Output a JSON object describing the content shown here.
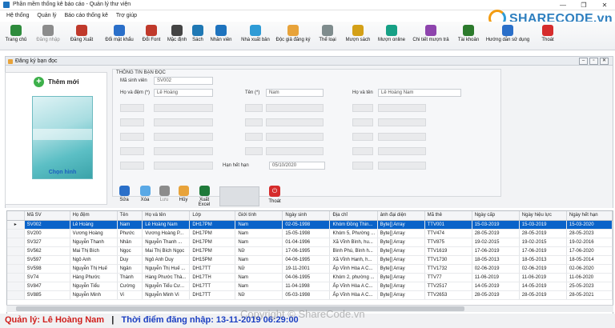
{
  "window": {
    "title": "Phần mềm thống kê báo cáo - Quản lý thư viện",
    "controls": [
      "—",
      "❐",
      "✕"
    ]
  },
  "menu": [
    "Hệ thống",
    "Quản lý",
    "Báo cáo thống kê",
    "Trợ giúp"
  ],
  "brand": {
    "text": "SHARECODE.vn"
  },
  "toolbar": [
    {
      "label": "Trang chủ",
      "icon": "home-icon",
      "color": "#2e8b3c",
      "disabled": false
    },
    {
      "label": "Đăng nhập",
      "icon": "login-icon",
      "color": "#8c8c8c",
      "disabled": true
    },
    {
      "label": "Đăng Xuất",
      "icon": "logout-icon",
      "color": "#c0392b",
      "disabled": false
    },
    {
      "label": "Đổi mật khẩu",
      "icon": "monitor-icon",
      "color": "#2a6fc9",
      "disabled": false
    },
    {
      "label": "Đổi Font",
      "icon": "font-icon",
      "color": "#c0392b",
      "disabled": false
    },
    {
      "label": "Mặc định",
      "icon": "gear-icon",
      "color": "#444444",
      "disabled": false
    },
    {
      "label": "Sách",
      "icon": "book-icon",
      "color": "#1f78b4",
      "disabled": false
    },
    {
      "label": "Nhân viên",
      "icon": "user-icon",
      "color": "#1e73be",
      "disabled": false
    },
    {
      "label": "Nhà xuất bản",
      "icon": "bird-icon",
      "color": "#2e9bd6",
      "disabled": false
    },
    {
      "label": "Độc giả đăng ký",
      "icon": "reader-icon",
      "color": "#e8a33a",
      "disabled": false
    },
    {
      "label": "Thể loại",
      "icon": "category-icon",
      "color": "#7f8c8d",
      "disabled": false
    },
    {
      "label": "Mượn sách",
      "icon": "borrow-icon",
      "color": "#d4a017",
      "disabled": false
    },
    {
      "label": "Mượn online",
      "icon": "online-icon",
      "color": "#16a085",
      "disabled": false
    },
    {
      "label": "Chi tiết mượn trả",
      "icon": "detail-icon",
      "color": "#8e44ad",
      "disabled": false
    },
    {
      "label": "Tài khoản",
      "icon": "account-icon",
      "color": "#2c7a2c",
      "disabled": false
    },
    {
      "label": "Hướng dẫn sử dụng",
      "icon": "help-icon",
      "color": "#2a6fc9",
      "disabled": false
    },
    {
      "label": "Thoát",
      "icon": "power-icon",
      "color": "#d62c2c",
      "disabled": false
    }
  ],
  "subwindow": {
    "title": "Đăng ký bạn đọc"
  },
  "form": {
    "add_button": "Thêm mới",
    "photo_caption": "Chọn hình",
    "group_title": "THÔNG TIN BẠN ĐỌC",
    "ma_sv_label": "Mã sinh viên",
    "ma_sv_value": "SV002",
    "ho_dem_label": "Họ và đệm (*)",
    "ho_dem_value": "Lê Hoàng",
    "ten_label": "Tên (*)",
    "ten_value": "Nam",
    "ho_ten_label": "Họ và tên",
    "ho_ten_value": "Lê Hoàng Nam",
    "han_label": "Hạn hết hạn",
    "han_value": "05/10/2020"
  },
  "actions": [
    {
      "label": "Sửa",
      "icon": "edit-icon",
      "color": "#2a6fc9",
      "disabled": false
    },
    {
      "label": "Xóa",
      "icon": "delete-icon",
      "color": "#5aa9e6",
      "disabled": false
    },
    {
      "label": "Lưu",
      "icon": "save-icon",
      "color": "#8c8c8c",
      "disabled": true
    },
    {
      "label": "Hủy",
      "icon": "undo-icon",
      "color": "#e8a33a",
      "disabled": false
    },
    {
      "label": "Xuất Excel",
      "icon": "excel-icon",
      "color": "#1f7a3a",
      "disabled": false
    }
  ],
  "exit_action": {
    "label": "Thoát"
  },
  "table": {
    "columns": [
      "Mã SV",
      "Họ đệm",
      "Tên",
      "Họ và tên",
      "Lớp",
      "Giới tính",
      "Ngày sinh",
      "Địa chỉ",
      "ảnh đại diện",
      "Mã thẻ",
      "Ngày cấp",
      "Ngày hiệu lực",
      "Ngày hết hạn"
    ],
    "rows": [
      [
        "SV002",
        "Lê Hoàng",
        "Nam",
        "Lê Hoàng Nam",
        "DH17PM",
        "Nam",
        "02-05-1998",
        "Khóm Đồng Thin...",
        "Byte[] Array",
        "TTV001",
        "15-03-2019",
        "15-03-2019",
        "15-03-2020"
      ],
      [
        "SV200",
        "Vương Hoàng",
        "Phước",
        "Vương Hoàng P...",
        "DH17PM",
        "Nam",
        "15-05-1998",
        "Khóm 5, Phường ...",
        "Byte[] Array",
        "TTV474",
        "28-05-2019",
        "28-05-2019",
        "28-05-2023"
      ],
      [
        "SV327",
        "Nguyễn Thanh",
        "Nhân",
        "Nguyễn Thanh ...",
        "DH17PM",
        "Nam",
        "01-04-1996",
        "Xã Vĩnh Bình, hu...",
        "Byte[] Array",
        "TTV875",
        "19-02-2015",
        "19-02-2015",
        "19-02-2016"
      ],
      [
        "SV562",
        "Mai Thị Bích",
        "Ngọc",
        "Mai Thị Bích Ngọc",
        "DH17PM",
        "Nữ",
        "17-06-1995",
        "Bình Phú, Bình h...",
        "Byte[] Array",
        "TTV1619",
        "17-06-2019",
        "17-06-2019",
        "17-06-2020"
      ],
      [
        "SV597",
        "Ngô Anh",
        "Duy",
        "Ngô Anh Duy",
        "DH15PM",
        "Nam",
        "04-06-1995",
        "Xã Vĩnh Hanh, h...",
        "Byte[] Array",
        "TTV1730",
        "18-05-2013",
        "18-05-2013",
        "18-05-2014"
      ],
      [
        "SV598",
        "Nguyễn Thị Huế",
        "Ngân",
        "Nguyễn Thị Huế ...",
        "DH17TT",
        "Nữ",
        "19-11-2001",
        "Ấp Vĩnh Hòa A C...",
        "Byte[] Array",
        "TTV1732",
        "02-06-2019",
        "02-06-2019",
        "02-06-2020"
      ],
      [
        "SV74",
        "Hàng Phước",
        "Thành",
        "Hàng Phước Thà...",
        "DH17TH",
        "Nam",
        "04-06-1995",
        "Khóm 2, phường ...",
        "Byte[] Array",
        "TTV77",
        "11-06-2019",
        "11-06-2019",
        "11-06-2020"
      ],
      [
        "SV847",
        "Nguyễn Tiểu",
        "Cường",
        "Nguyễn Tiểu Cư...",
        "DH17TT",
        "Nam",
        "11-04-1998",
        "Ấp Vĩnh Hòa A C...",
        "Byte[] Array",
        "TTV2517",
        "14-05-2019",
        "14-05-2019",
        "25-05-2023"
      ],
      [
        "SV885",
        "Nguyễn Minh",
        "Vi",
        "Nguyễn Minh Vi",
        "DH17TT",
        "Nữ",
        "05-03-1998",
        "Ấp Vĩnh Hòa A C...",
        "Byte[] Array",
        "TTV2653",
        "28-05-2019",
        "28-05-2019",
        "28-05-2021"
      ]
    ]
  },
  "status": {
    "user_label": "Quản lý: Lê Hoàng Nam",
    "separator": "|",
    "login_time": "Thời điểm đăng nhập: 13-11-2019 06:29:00"
  },
  "watermark": "Copyright © ShareCode.vn"
}
